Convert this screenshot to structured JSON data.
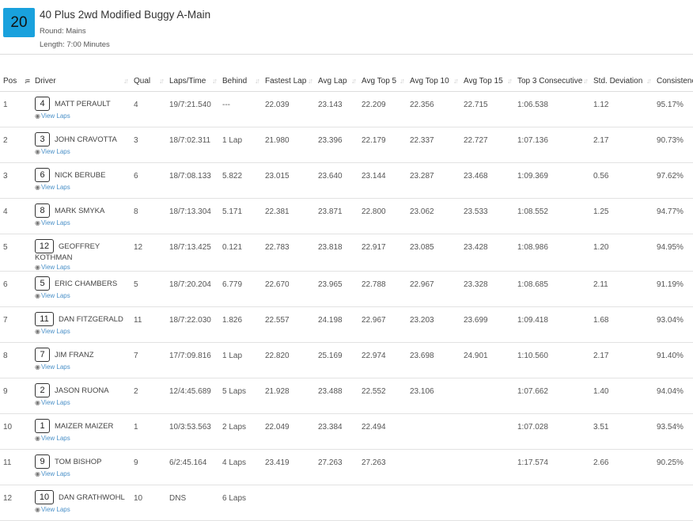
{
  "race": {
    "number": "20",
    "title": "40 Plus 2wd Modified Buggy A-Main",
    "round": "Round: Mains",
    "length": "Length: 7:00 Minutes"
  },
  "columns": [
    {
      "key": "pos",
      "label": "Pos",
      "sort": "sort-asc-icon"
    },
    {
      "key": "driver",
      "label": "Driver",
      "sort": "sort-icon"
    },
    {
      "key": "qual",
      "label": "Qual",
      "sort": "sort-icon"
    },
    {
      "key": "laps_time",
      "label": "Laps/Time",
      "sort": "sort-icon"
    },
    {
      "key": "behind",
      "label": "Behind",
      "sort": "sort-icon"
    },
    {
      "key": "fastest",
      "label": "Fastest Lap",
      "sort": "sort-icon"
    },
    {
      "key": "avg_lap",
      "label": "Avg Lap",
      "sort": "sort-icon"
    },
    {
      "key": "avg5",
      "label": "Avg Top 5",
      "sort": "sort-icon"
    },
    {
      "key": "avg10",
      "label": "Avg Top 10",
      "sort": "sort-icon"
    },
    {
      "key": "avg15",
      "label": "Avg Top 15",
      "sort": "sort-icon"
    },
    {
      "key": "top3",
      "label": "Top 3 Consecutive",
      "sort": "sort-icon"
    },
    {
      "key": "std",
      "label": "Std. Deviation",
      "sort": "sort-icon"
    },
    {
      "key": "cons",
      "label": "Consistency",
      "sort": "sort-icon"
    }
  ],
  "view_laps_label": "View Laps",
  "rows": [
    {
      "pos": "1",
      "car": "4",
      "driver": "MATT PERAULT",
      "qual": "4",
      "laps_time": "19/7:21.540",
      "behind": "---",
      "fastest": "22.039",
      "avg_lap": "23.143",
      "avg5": "22.209",
      "avg10": "22.356",
      "avg15": "22.715",
      "top3": "1:06.538",
      "std": "1.12",
      "cons": "95.17%"
    },
    {
      "pos": "2",
      "car": "3",
      "driver": "JOHN CRAVOTTA",
      "qual": "3",
      "laps_time": "18/7:02.311",
      "behind": "1 Lap",
      "fastest": "21.980",
      "avg_lap": "23.396",
      "avg5": "22.179",
      "avg10": "22.337",
      "avg15": "22.727",
      "top3": "1:07.136",
      "std": "2.17",
      "cons": "90.73%"
    },
    {
      "pos": "3",
      "car": "6",
      "driver": "NICK BERUBE",
      "qual": "6",
      "laps_time": "18/7:08.133",
      "behind": "5.822",
      "fastest": "23.015",
      "avg_lap": "23.640",
      "avg5": "23.144",
      "avg10": "23.287",
      "avg15": "23.468",
      "top3": "1:09.369",
      "std": "0.56",
      "cons": "97.62%"
    },
    {
      "pos": "4",
      "car": "8",
      "driver": "MARK SMYKA",
      "qual": "8",
      "laps_time": "18/7:13.304",
      "behind": "5.171",
      "fastest": "22.381",
      "avg_lap": "23.871",
      "avg5": "22.800",
      "avg10": "23.062",
      "avg15": "23.533",
      "top3": "1:08.552",
      "std": "1.25",
      "cons": "94.77%"
    },
    {
      "pos": "5",
      "car": "12",
      "driver": "GEOFFREY KOTHMAN",
      "qual": "12",
      "laps_time": "18/7:13.425",
      "behind": "0.121",
      "fastest": "22.783",
      "avg_lap": "23.818",
      "avg5": "22.917",
      "avg10": "23.085",
      "avg15": "23.428",
      "top3": "1:08.986",
      "std": "1.20",
      "cons": "94.95%"
    },
    {
      "pos": "6",
      "car": "5",
      "driver": "ERIC CHAMBERS",
      "qual": "5",
      "laps_time": "18/7:20.204",
      "behind": "6.779",
      "fastest": "22.670",
      "avg_lap": "23.965",
      "avg5": "22.788",
      "avg10": "22.967",
      "avg15": "23.328",
      "top3": "1:08.685",
      "std": "2.11",
      "cons": "91.19%"
    },
    {
      "pos": "7",
      "car": "11",
      "driver": "DAN FITZGERALD",
      "qual": "11",
      "laps_time": "18/7:22.030",
      "behind": "1.826",
      "fastest": "22.557",
      "avg_lap": "24.198",
      "avg5": "22.967",
      "avg10": "23.203",
      "avg15": "23.699",
      "top3": "1:09.418",
      "std": "1.68",
      "cons": "93.04%"
    },
    {
      "pos": "8",
      "car": "7",
      "driver": "JIM FRANZ",
      "qual": "7",
      "laps_time": "17/7:09.816",
      "behind": "1 Lap",
      "fastest": "22.820",
      "avg_lap": "25.169",
      "avg5": "22.974",
      "avg10": "23.698",
      "avg15": "24.901",
      "top3": "1:10.560",
      "std": "2.17",
      "cons": "91.40%"
    },
    {
      "pos": "9",
      "car": "2",
      "driver": "JASON RUONA",
      "qual": "2",
      "laps_time": "12/4:45.689",
      "behind": "5 Laps",
      "fastest": "21.928",
      "avg_lap": "23.488",
      "avg5": "22.552",
      "avg10": "23.106",
      "avg15": "",
      "top3": "1:07.662",
      "std": "1.40",
      "cons": "94.04%"
    },
    {
      "pos": "10",
      "car": "1",
      "driver": "MAIZER MAIZER",
      "qual": "1",
      "laps_time": "10/3:53.563",
      "behind": "2 Laps",
      "fastest": "22.049",
      "avg_lap": "23.384",
      "avg5": "22.494",
      "avg10": "",
      "avg15": "",
      "top3": "1:07.028",
      "std": "3.51",
      "cons": "93.54%"
    },
    {
      "pos": "11",
      "car": "9",
      "driver": "TOM BISHOP",
      "qual": "9",
      "laps_time": "6/2:45.164",
      "behind": "4 Laps",
      "fastest": "23.419",
      "avg_lap": "27.263",
      "avg5": "27.263",
      "avg10": "",
      "avg15": "",
      "top3": "1:17.574",
      "std": "2.66",
      "cons": "90.25%"
    },
    {
      "pos": "12",
      "car": "10",
      "driver": "DAN GRATHWOHL",
      "qual": "10",
      "laps_time": "DNS",
      "behind": "6 Laps",
      "fastest": "",
      "avg_lap": "",
      "avg5": "",
      "avg10": "",
      "avg15": "",
      "top3": "",
      "std": "",
      "cons": ""
    }
  ]
}
